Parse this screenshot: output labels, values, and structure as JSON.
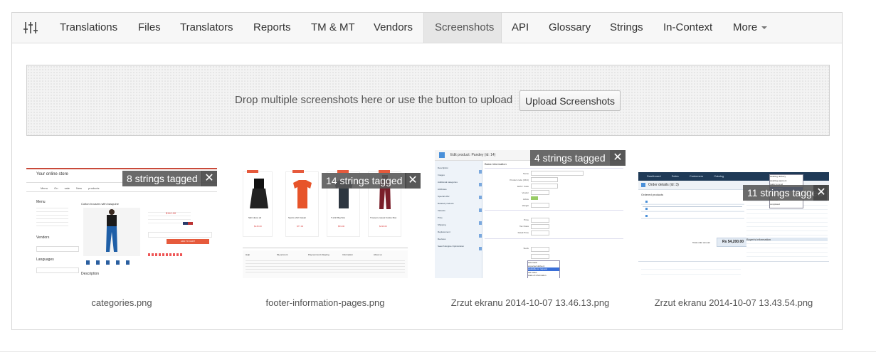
{
  "nav": {
    "settings_icon": "sliders-icon",
    "items": [
      "Translations",
      "Files",
      "Translators",
      "Reports",
      "TM & MT",
      "Vendors",
      "Screenshots",
      "API",
      "Glossary",
      "Strings",
      "In-Context",
      "More"
    ],
    "active": "Screenshots"
  },
  "dropzone": {
    "text": "Drop multiple screenshots here or use the button to upload",
    "button_label": "Upload Screenshots"
  },
  "screenshots": [
    {
      "filename": "categories.png",
      "tag": "8 strings tagged",
      "preview": {
        "store_title": "Your online store",
        "menu": [
          "Menu",
          "On sale",
          "New products"
        ],
        "sidebar_menu": "Menu",
        "vendors": "Vendors",
        "languages": "Languages",
        "product_title": "Cotton trousers with basquine",
        "price": "$110.00",
        "add_to_cart": "ADD TO CART",
        "description": "Description"
      }
    },
    {
      "filename": "footer-information-pages.png",
      "tag": "14 strings tagged",
      "preview": {
        "products": [
          {
            "name": "Skirt dress all",
            "price": "$145.00"
          },
          {
            "name": "Sports shirt Kawaii",
            "price": "$77.00"
          },
          {
            "name": "T-shirt Big Size",
            "price": "$59.00"
          },
          {
            "name": "Trousers casual Carlos Max",
            "price": "$430.00"
          }
        ],
        "footer_cols": [
          "Help",
          "My account",
          "Payment and shipping",
          "Information",
          "About us"
        ]
      }
    },
    {
      "filename": "Zrzut ekranu 2014-10-07 13.46.13.png",
      "tag": "4 strings tagged",
      "preview": {
        "title": "Edit product: Pandey (id: 14)",
        "section": "Basic information",
        "side_items": [
          "Description",
          "Images",
          "Additional categories",
          "Attributes",
          "Special offer",
          "Related products",
          "Variants",
          "Price",
          "Shipping",
          "Replacement",
          "Reviews",
          "Search Engine Optimization"
        ],
        "fields": [
          "Name",
          "Product code (SKU)",
          "EAN / Code",
          "Vendor",
          "Active",
          "Weight",
          "Price",
          "Stock",
          "Tax Class",
          "Retail Price"
        ],
        "dropdown": [
          "automatic",
          "expected delivery",
          "available on request",
          "ask sales",
          "state of information"
        ]
      }
    },
    {
      "filename": "Zrzut ekranu 2014-10-07 13.43.54.png",
      "tag": "11 strings tagged",
      "preview": {
        "topbar": [
          "Dashboard",
          "Sales",
          "Customers",
          "Catalog"
        ],
        "title": "Order details (id: 3)",
        "ordered_products": "Ordered products",
        "total": "Rs 54,200.00",
        "total_label": "Total order amount",
        "buyer_info": "Buyer's information",
        "dropdown": [
          "awaiting delivery",
          "awaiting payment",
          "ready to send",
          "in preparation",
          "cancelled",
          "shipped",
          "returned",
          "completed"
        ]
      }
    }
  ]
}
